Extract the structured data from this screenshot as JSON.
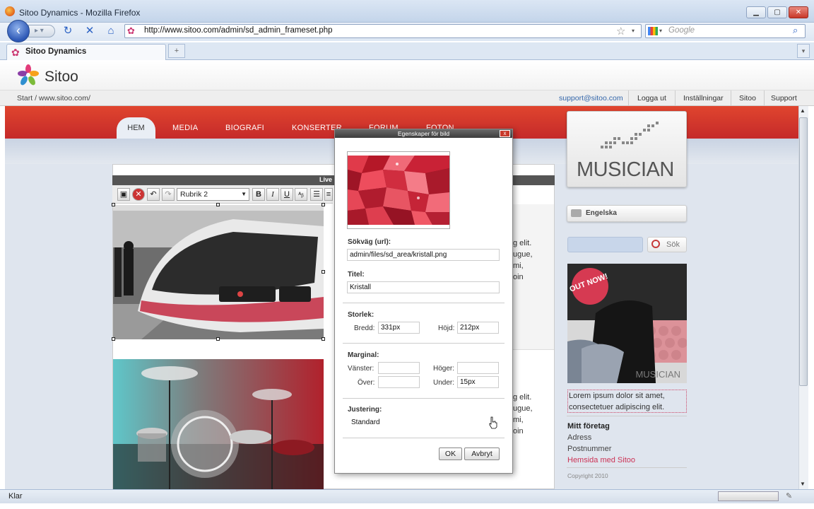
{
  "window": {
    "title": "Sitoo Dynamics - Mozilla Firefox",
    "minimize": "▁",
    "maximize": "▢",
    "close": "✕"
  },
  "browser": {
    "url": "http://www.sitoo.com/admin/sd_admin_frameset.php",
    "search_placeholder": "Google",
    "tab_title": "Sitoo Dynamics",
    "new_tab": "+",
    "status": "Klar"
  },
  "sitoo": {
    "brand": "Sitoo",
    "breadcrumb": "Start / www.sitoo.com/",
    "admin_links": [
      "support@sitoo.com",
      "Logga ut",
      "Inställningar",
      "Sitoo",
      "Support"
    ]
  },
  "site": {
    "nav": [
      "HEM",
      "MEDIA",
      "BIOGRAFI",
      "KONSERTER",
      "FORUM",
      "FOTON"
    ],
    "editor_label": "Live",
    "style_select": "Rubrik 2",
    "toolbar": {
      "bold": "B",
      "italic": "I",
      "underline": "U"
    },
    "body_lines": [
      "g elit.",
      "ugue,",
      "mi,",
      "oin"
    ],
    "body_lines2": [
      "g elit.",
      "ugue,",
      "mi,",
      "oin"
    ],
    "logo_word": "MUSICIAN",
    "language_button": "Engelska",
    "search_button": "Sök",
    "promo_badge": "OUT NOW!",
    "promo_word": "MUSICIAN",
    "promo_text": "Lorem ipsum dolor sit amet, consectetuer adipiscing elit.",
    "company": {
      "name": "Mitt företag",
      "address": "Adress",
      "postal": "Postnummer",
      "link": "Hemsida med Sitoo"
    },
    "copyright": "Copyright 2010"
  },
  "dialog": {
    "title": "Egenskaper för bild",
    "close": "x",
    "path_label": "Sökväg (url):",
    "path_value": "admin/files/sd_area/kristall.png",
    "title_label": "Titel:",
    "title_value": "Kristall",
    "size_label": "Storlek:",
    "width_label": "Bredd:",
    "width_value": "331px",
    "height_label": "Höjd:",
    "height_value": "212px",
    "margin_label": "Marginal:",
    "left_label": "Vänster:",
    "left_value": "",
    "right_label": "Höger:",
    "right_value": "",
    "top_label": "Över:",
    "top_value": "",
    "bottom_label": "Under:",
    "bottom_value": "15px",
    "align_label": "Justering:",
    "align_value": "Standard",
    "ok": "OK",
    "cancel": "Avbryt"
  },
  "colors": {
    "brand_red": "#d33a2c",
    "link_blue": "#3366aa",
    "accent_pink": "#cc3355"
  }
}
